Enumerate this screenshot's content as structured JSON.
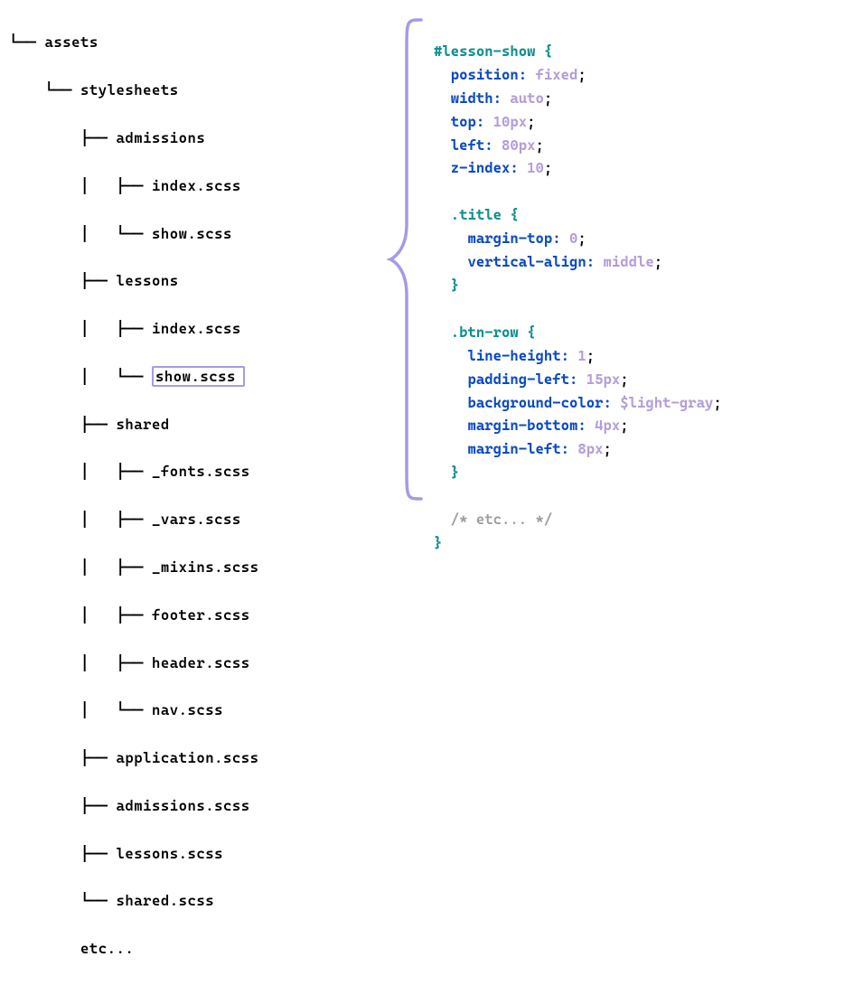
{
  "tree": {
    "root": "assets",
    "level2": "stylesheets",
    "folders": {
      "admissions": [
        "index.scss",
        "show.scss"
      ],
      "lessons": [
        "index.scss",
        "show.scss"
      ],
      "shared": [
        "_fonts.scss",
        "_vars.scss",
        "_mixins.scss",
        "footer.scss",
        "header.scss",
        "nav.scss"
      ]
    },
    "top_files": [
      "application.scss",
      "admissions.scss",
      "lessons.scss",
      "shared.scss"
    ],
    "trailing": "etc...",
    "highlighted_path": "lessons/show.scss"
  },
  "code": {
    "rule_selector": "#lesson-show",
    "props": [
      {
        "name": "position",
        "value": "fixed"
      },
      {
        "name": "width",
        "value": "auto"
      },
      {
        "name": "top",
        "value": "10px"
      },
      {
        "name": "left",
        "value": "80px"
      },
      {
        "name": "z-index",
        "value": "10"
      }
    ],
    "nested": [
      {
        "selector": ".title",
        "props": [
          {
            "name": "margin-top",
            "value": "0"
          },
          {
            "name": "vertical-align",
            "value": "middle"
          }
        ]
      },
      {
        "selector": ".btn-row",
        "props": [
          {
            "name": "line-height",
            "value": "1"
          },
          {
            "name": "padding-left",
            "value": "15px"
          },
          {
            "name": "background-color",
            "value": "$light-gray"
          },
          {
            "name": "margin-bottom",
            "value": "4px"
          },
          {
            "name": "margin-left",
            "value": "8px"
          }
        ]
      }
    ],
    "comment": "/* etc... */"
  },
  "glyphs": {
    "elbow": "└──",
    "tee": "├──",
    "pipe": "│"
  }
}
